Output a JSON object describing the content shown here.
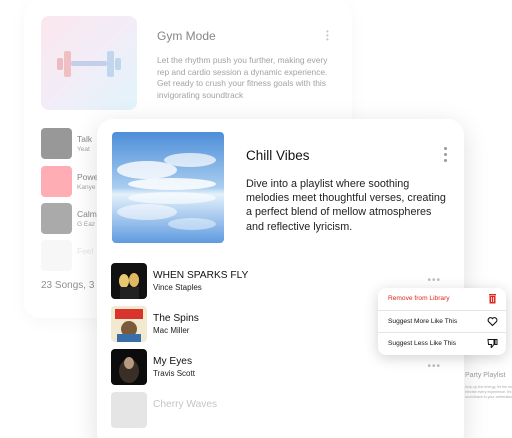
{
  "gym_mode": {
    "title": "Gym Mode",
    "description": "Let the rhythm push you further, making every rep and cardio session a dynamic experience. Get ready to crush your fitness goals with this invigorating soundtrack",
    "tracks": [
      {
        "name": "Talk",
        "artist": "Yeat"
      },
      {
        "name": "Powe",
        "artist": "Kanye"
      },
      {
        "name": "Calm",
        "artist": "G Eaz"
      },
      {
        "name": "Feel",
        "artist": ""
      }
    ],
    "song_count": "23 Songs, 3"
  },
  "chill_vibes": {
    "title": "Chill Vibes",
    "description": "Dive into a playlist where soothing melodies meet thoughtful verses, creating a perfect blend of mellow atmospheres and reflective lyricism.",
    "tracks": [
      {
        "name": "WHEN SPARKS FLY",
        "artist": "Vince Staples"
      },
      {
        "name": "The Spins",
        "artist": "Mac Miller"
      },
      {
        "name": "My Eyes",
        "artist": "Travis Scott"
      },
      {
        "name": "Cherry Waves",
        "artist": ""
      }
    ],
    "more_glyph": "•••"
  },
  "context_menu": {
    "items": [
      {
        "label": "Remove from Library",
        "icon": "trash-icon"
      },
      {
        "label": "Suggest More Like This",
        "icon": "heart-icon"
      },
      {
        "label": "Suggest Less Like This",
        "icon": "thumbs-down-icon"
      }
    ],
    "danger_color": "#e0271f"
  },
  "party_playlist": {
    "title": "Party Playlist",
    "description": "Amp up the energy, let the music elevate every experience. It's the soundtrack to your celebrations"
  },
  "icons": {
    "gym_cover": "dumbbell-icon",
    "kebab": "kebab-menu-icon"
  }
}
